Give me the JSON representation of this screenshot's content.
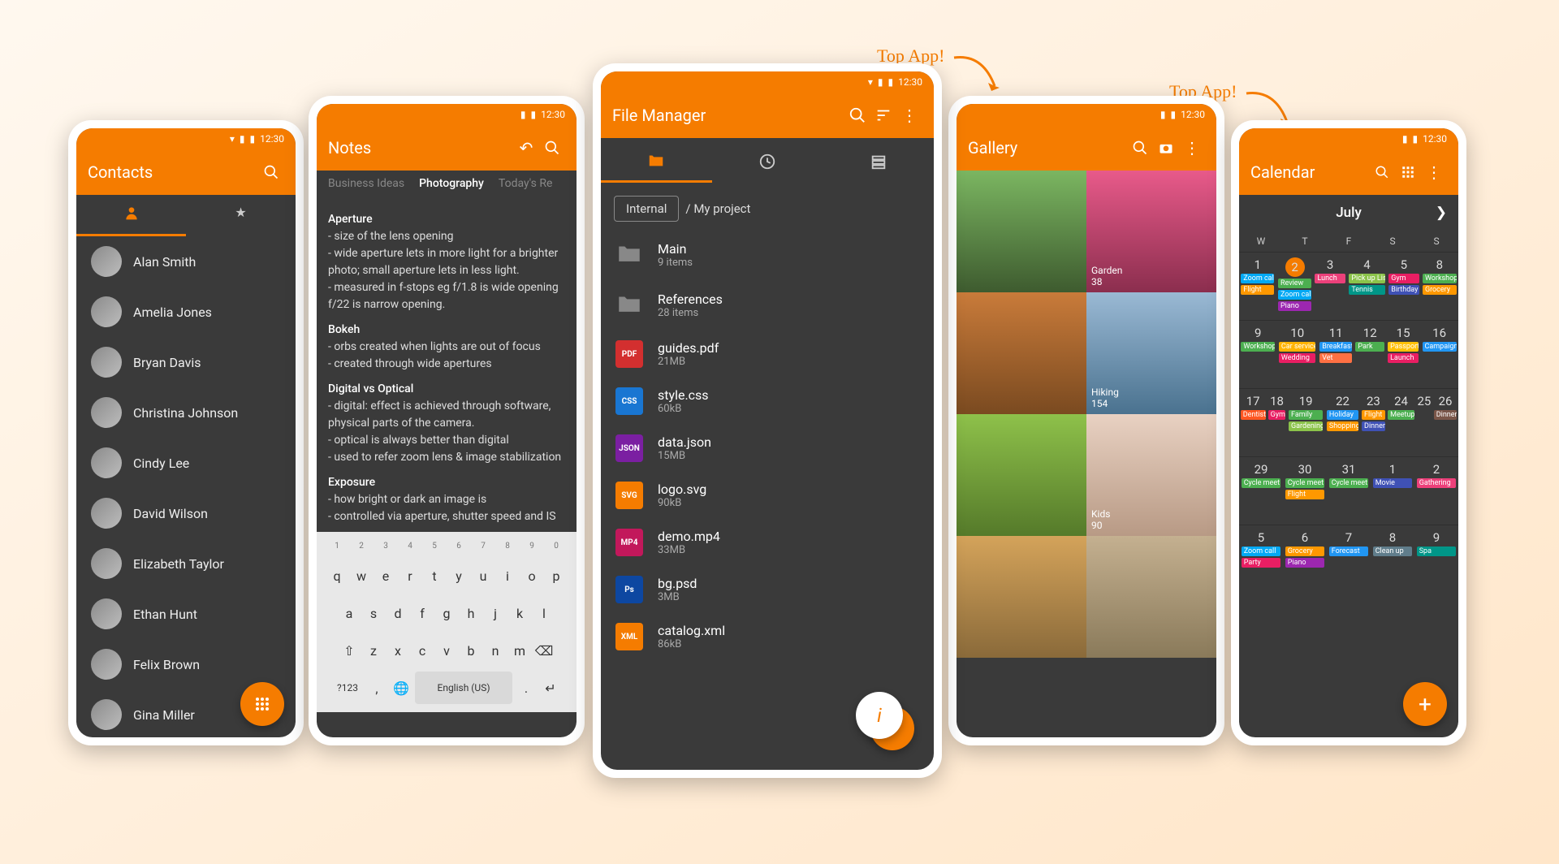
{
  "status_time": "12:30",
  "callouts": [
    "Top App!",
    "Top App!"
  ],
  "contacts": {
    "title": "Contacts",
    "list": [
      "Alan Smith",
      "Amelia Jones",
      "Bryan Davis",
      "Christina Johnson",
      "Cindy Lee",
      "David Wilson",
      "Elizabeth Taylor",
      "Ethan Hunt",
      "Felix Brown",
      "Gina Miller"
    ]
  },
  "notes": {
    "title": "Notes",
    "tabs": [
      "Business Ideas",
      "Photography",
      "Today's Re"
    ],
    "active_tab": "Photography",
    "sections": [
      {
        "h": "Aperture",
        "lines": [
          "- size of the lens opening",
          "- wide aperture lets in more light for a brighter photo; small aperture lets in less light.",
          "- measured in f-stops eg f/1.8 is wide opening f/22 is narrow opening."
        ]
      },
      {
        "h": "Bokeh",
        "lines": [
          "- orbs created when lights are out of focus",
          "- created through wide apertures"
        ]
      },
      {
        "h": "Digital vs Optical",
        "lines": [
          "- digital: effect is achieved through software, physical parts of the camera.",
          "- optical is always better than digital",
          "- used to refer zoom lens & image stabilization"
        ]
      },
      {
        "h": "Exposure",
        "lines": [
          "- how bright or dark an image is",
          "- controlled via aperture, shutter speed and IS"
        ]
      }
    ],
    "kbd_lang": "English (US)"
  },
  "fm": {
    "title": "File Manager",
    "bc_root": "Internal",
    "bc_path": "/ My project",
    "items": [
      {
        "type": "folder",
        "name": "Main",
        "size": "9 items"
      },
      {
        "type": "folder",
        "name": "References",
        "size": "28 items"
      },
      {
        "type": "pdf",
        "name": "guides.pdf",
        "size": "21MB",
        "bg": "#d32f2f",
        "label": "PDF"
      },
      {
        "type": "css",
        "name": "style.css",
        "size": "60kB",
        "bg": "#1976d2",
        "label": "CSS"
      },
      {
        "type": "json",
        "name": "data.json",
        "size": "15MB",
        "bg": "#7b1fa2",
        "label": "JSON"
      },
      {
        "type": "svg",
        "name": "logo.svg",
        "size": "90kB",
        "bg": "#f57c00",
        "label": "SVG"
      },
      {
        "type": "mp4",
        "name": "demo.mp4",
        "size": "33MB",
        "bg": "#c2185b",
        "label": "MP4"
      },
      {
        "type": "psd",
        "name": "bg.psd",
        "size": "3MB",
        "bg": "#0d47a1",
        "label": "Ps"
      },
      {
        "type": "xml",
        "name": "catalog.xml",
        "size": "86kB",
        "bg": "#f57c00",
        "label": "XML"
      }
    ]
  },
  "gallery": {
    "title": "Gallery",
    "albums": [
      {
        "name": "",
        "count": ""
      },
      {
        "name": "Garden",
        "count": "38"
      },
      {
        "name": "",
        "count": ""
      },
      {
        "name": "Hiking",
        "count": "154"
      },
      {
        "name": "",
        "count": ""
      },
      {
        "name": "Kids",
        "count": "90"
      },
      {
        "name": "",
        "count": ""
      },
      {
        "name": "",
        "count": ""
      }
    ]
  },
  "calendar": {
    "title": "Calendar",
    "month": "July",
    "dow": [
      "W",
      "T",
      "F",
      "S",
      "S"
    ],
    "weeks": [
      [
        {
          "n": "1",
          "e": [
            [
              "Zoom call",
              "#03a9f4"
            ],
            [
              "Flight",
              "#ff9800"
            ]
          ]
        },
        {
          "n": "2",
          "today": true,
          "e": [
            [
              "Review",
              "#4caf50"
            ],
            [
              "Zoom call",
              "#03a9f4"
            ],
            [
              "Piano",
              "#9c27b0"
            ]
          ]
        },
        {
          "n": "3",
          "e": [
            [
              "Lunch",
              "#ec407a"
            ]
          ]
        },
        {
          "n": "4",
          "e": [
            [
              "Pick up Lis",
              "#8bc34a"
            ],
            [
              "Tennis",
              "#009688"
            ]
          ]
        },
        {
          "n": "5",
          "e": [
            [
              "Gym",
              "#e91e63"
            ],
            [
              "Birthday",
              "#3f51b5"
            ]
          ]
        }
      ],
      [
        {
          "n": "8",
          "e": [
            [
              "Workshop",
              "#4caf50"
            ],
            [
              "Grocery",
              "#ff9800"
            ]
          ]
        },
        {
          "n": "9",
          "e": [
            [
              "Workshop",
              "#4caf50"
            ]
          ]
        },
        {
          "n": "10",
          "e": [
            [
              "Car service",
              "#ffb300"
            ],
            [
              "Wedding",
              "#e91e63"
            ]
          ]
        },
        {
          "n": "11",
          "e": [
            [
              "Breakfast",
              "#2196f3"
            ],
            [
              "Vet",
              "#ff7043"
            ]
          ]
        },
        {
          "n": "12",
          "e": [
            [
              "Park",
              "#4caf50"
            ]
          ]
        }
      ],
      [
        {
          "n": "15",
          "e": [
            [
              "Passport",
              "#ffc107"
            ],
            [
              "Launch",
              "#e91e63"
            ]
          ]
        },
        {
          "n": "16",
          "e": [
            [
              "Campaign",
              "#2196f3"
            ]
          ]
        },
        {
          "n": "17",
          "e": [
            [
              "Dentist",
              "#ff5722"
            ]
          ]
        },
        {
          "n": "18",
          "e": [
            [
              "Gym",
              "#e91e63"
            ]
          ]
        },
        {
          "n": "19",
          "e": [
            [
              "Family",
              "#4caf50"
            ],
            [
              "Gardening",
              "#8bc34a"
            ]
          ]
        }
      ],
      [
        {
          "n": "22",
          "e": [
            [
              "Holiday",
              "#2196f3"
            ],
            [
              "Shopping",
              "#ff9800"
            ]
          ]
        },
        {
          "n": "23",
          "e": [
            [
              "Flight",
              "#ff9800"
            ],
            [
              "Dinner",
              "#3f51b5"
            ]
          ]
        },
        {
          "n": "24",
          "e": [
            [
              "Meetup",
              "#4caf50"
            ]
          ]
        },
        {
          "n": "25",
          "e": []
        },
        {
          "n": "26",
          "e": [
            [
              "Dinner",
              "#795548"
            ]
          ]
        }
      ],
      [
        {
          "n": "29",
          "e": [
            [
              "Cycle meet",
              "#4caf50"
            ]
          ]
        },
        {
          "n": "30",
          "e": [
            [
              "Cycle meet",
              "#4caf50"
            ],
            [
              "Flight",
              "#ff9800"
            ]
          ]
        },
        {
          "n": "31",
          "e": [
            [
              "Cycle meet",
              "#4caf50"
            ]
          ]
        },
        {
          "n": "1",
          "e": [
            [
              "Movie",
              "#3f51b5"
            ]
          ]
        },
        {
          "n": "2",
          "e": [
            [
              "Gathering",
              "#ec407a"
            ]
          ]
        }
      ],
      [
        {
          "n": "5",
          "e": [
            [
              "Zoom call",
              "#03a9f4"
            ],
            [
              "Party",
              "#e91e63"
            ]
          ]
        },
        {
          "n": "6",
          "e": [
            [
              "Grocery",
              "#ff9800"
            ],
            [
              "Piano",
              "#9c27b0"
            ]
          ]
        },
        {
          "n": "7",
          "e": [
            [
              "Forecast",
              "#2196f3"
            ]
          ]
        },
        {
          "n": "8",
          "e": [
            [
              "Clean up",
              "#607d8b"
            ]
          ]
        },
        {
          "n": "9",
          "e": [
            [
              "Spa",
              "#009688"
            ]
          ]
        }
      ]
    ]
  }
}
